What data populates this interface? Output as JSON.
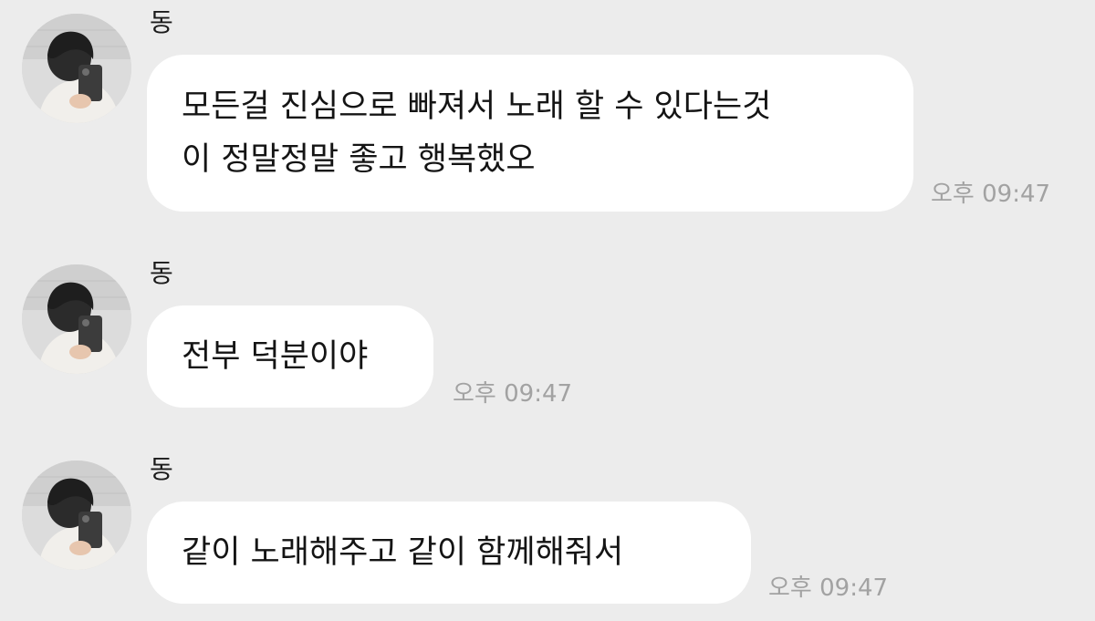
{
  "messages": [
    {
      "sender": "동",
      "text": "모든걸 진심으로 빠져서 노래 할 수 있다는것\n이 정말정말 좋고 행복했오",
      "time": "오후 09:47",
      "avatar": "profile-photo"
    },
    {
      "sender": "동",
      "text": "전부 덕분이야",
      "time": "오후 09:47",
      "avatar": "profile-photo"
    },
    {
      "sender": "동",
      "text": "같이 노래해주고 같이 함께해줘서",
      "time": "오후 09:47",
      "avatar": "profile-photo"
    }
  ],
  "colors": {
    "background": "#ececec",
    "bubble": "#ffffff",
    "timestamp": "#a2a2a2"
  }
}
